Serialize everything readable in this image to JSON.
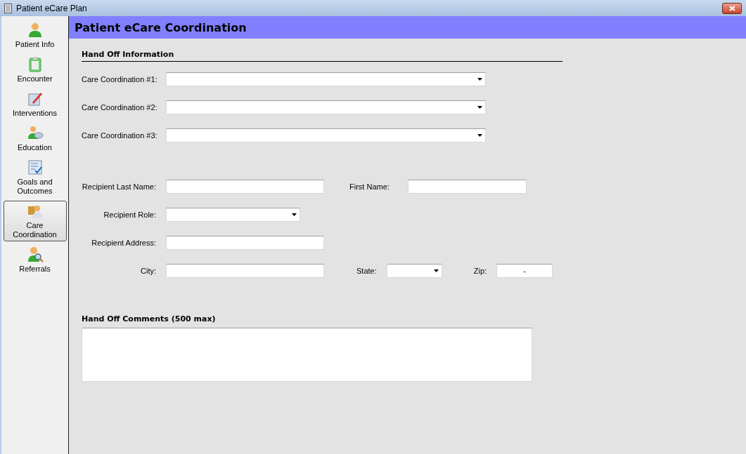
{
  "window": {
    "title": "Patient eCare Plan"
  },
  "sidebar": {
    "items": [
      {
        "label": "Patient Info",
        "selected": false
      },
      {
        "label": "Encounter",
        "selected": false
      },
      {
        "label": "Interventions",
        "selected": false
      },
      {
        "label": "Education",
        "selected": false
      },
      {
        "label": "Goals and Outcomes",
        "selected": false
      },
      {
        "label": "Care Coordination",
        "selected": true
      },
      {
        "label": "Referrals",
        "selected": false
      }
    ]
  },
  "header": {
    "title": "Patient eCare Coordination"
  },
  "hand_off_information": {
    "heading": "Hand Off Information",
    "fields": [
      {
        "label": "Care Coordination #1:",
        "kind": "dropdown"
      },
      {
        "label": "Care Coordination #2:",
        "kind": "dropdown"
      },
      {
        "label": "Care Coordination #3:",
        "kind": "dropdown"
      }
    ]
  },
  "recipient": {
    "rows": [
      [
        {
          "label": "Recipient Last Name:",
          "kind": "text"
        },
        {
          "label": "First Name:",
          "kind": "text"
        }
      ],
      [
        {
          "label": "Recipient Role:",
          "kind": "dropdown"
        }
      ],
      [
        {
          "label": "Recipient Address:",
          "kind": "text"
        }
      ],
      [
        {
          "label": "City:",
          "kind": "text"
        },
        {
          "label": "State:",
          "kind": "dropdown"
        },
        {
          "label": "Zip:",
          "kind": "text",
          "value": "-"
        }
      ]
    ]
  },
  "comments": {
    "heading": "Hand Off Comments (500 max)"
  }
}
